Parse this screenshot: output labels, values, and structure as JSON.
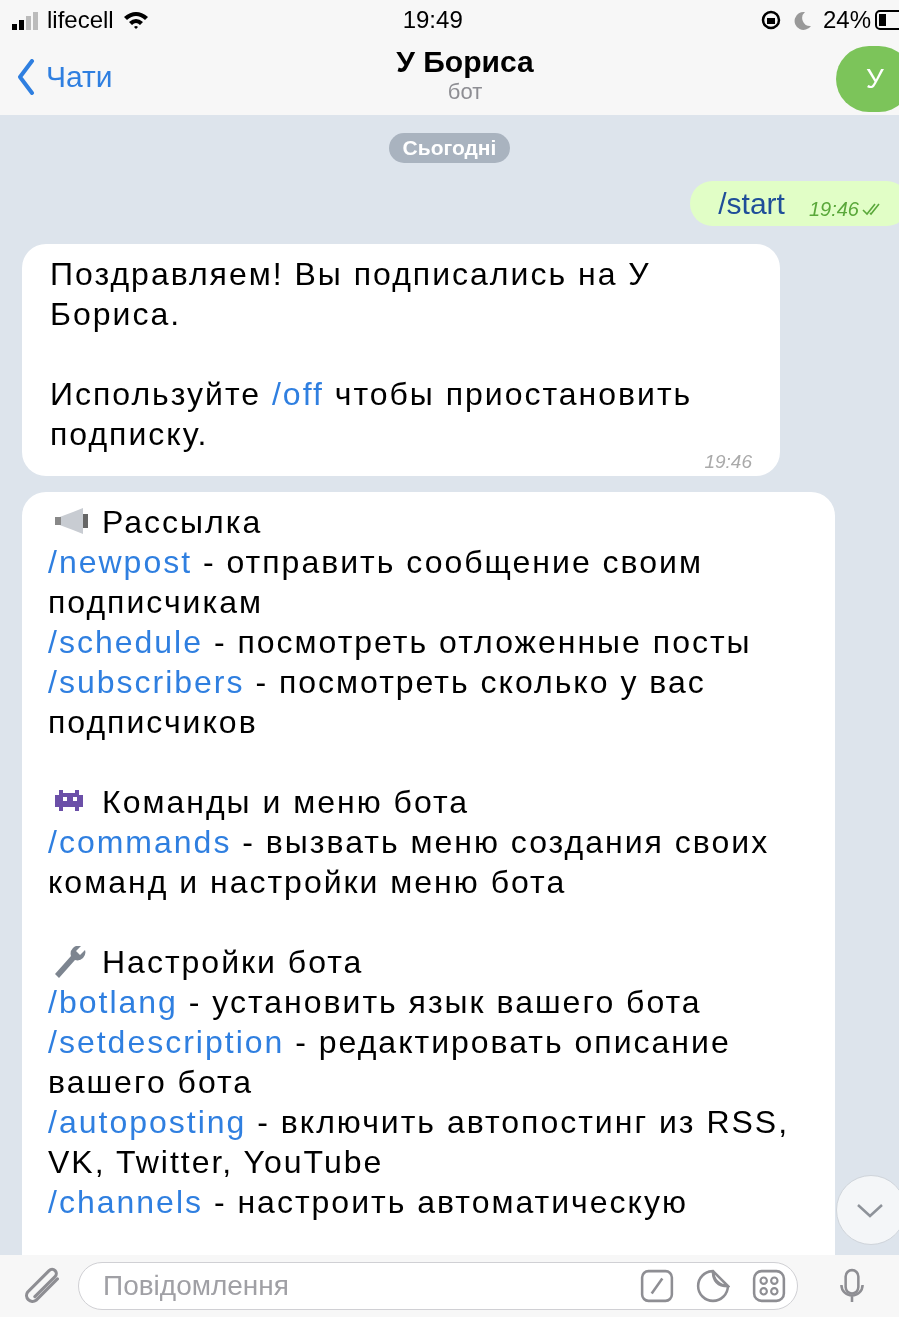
{
  "status_bar": {
    "carrier": "lifecell",
    "time": "19:49",
    "battery": "24%"
  },
  "header": {
    "back": "Чати",
    "title": "У Бориса",
    "subtitle": "бот",
    "avatar": "У"
  },
  "date_chip": "Сьогодні",
  "messages": [
    {
      "kind": "outgoing",
      "text": "/start",
      "time": "19:46",
      "read": true
    },
    {
      "kind": "incoming",
      "time": "19:46",
      "paragraphs": [
        [
          {
            "kind": "text",
            "text": "Поздравляем! Вы подписались на У Бориса."
          }
        ],
        [
          {
            "kind": "text",
            "text": "Используйте "
          },
          {
            "kind": "link",
            "text": "/off"
          },
          {
            "kind": "text",
            "text": " чтобы приостановить подписку."
          }
        ]
      ]
    },
    {
      "kind": "menu",
      "sections": [
        {
          "title": "Рассылка",
          "entries": [
            {
              "command": "/newpost",
              "text": " - отправить сообщение своим подписчикам"
            },
            {
              "command": "/schedule",
              "text": " - посмотреть отложенные посты"
            },
            {
              "command": "/subscribers",
              "text": " - посмотреть сколько у вас подписчиков"
            }
          ]
        },
        {
          "title": "Команды и меню бота",
          "entries": [
            {
              "command": "/commands",
              "text": " - вызвать меню создания своих команд и настройки меню бота"
            }
          ]
        },
        {
          "title": "Настройки бота",
          "entries": [
            {
              "command": "/botlang",
              "text": " - установить язык вашего бота"
            },
            {
              "command": "/setdescription",
              "text": " - редактировать описание вашего бота"
            },
            {
              "command": "/autoposting",
              "text": " - включить автопостинг из RSS, VK, Twitter, YouTube"
            },
            {
              "command": "/channels",
              "text": " - настроить автоматическую"
            }
          ]
        }
      ]
    }
  ],
  "composer": {
    "placeholder": "Повідомлення"
  }
}
